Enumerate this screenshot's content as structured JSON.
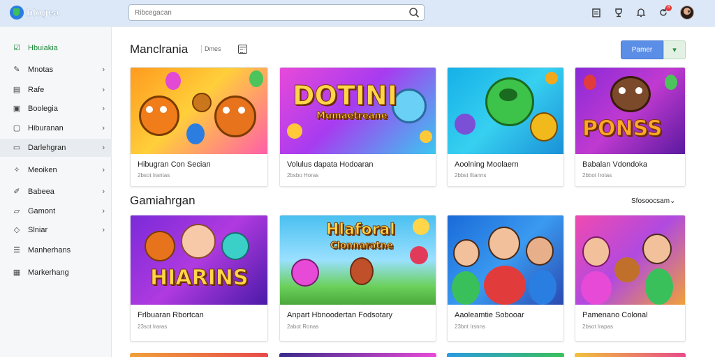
{
  "header": {
    "logo_text": "blogea",
    "search_placeholder": "Ribcegacan",
    "avatar_badge": "8"
  },
  "sidebar": {
    "items": [
      {
        "label": "Hbuiakia",
        "icon": "check-square-icon",
        "chevron": false
      },
      {
        "label": "Mnotas",
        "icon": "pencil-icon",
        "chevron": true
      },
      {
        "label": "Rafe",
        "icon": "doc-icon",
        "chevron": true
      },
      {
        "label": "Boolegia",
        "icon": "image-icon",
        "chevron": true
      },
      {
        "label": "Hiburanan",
        "icon": "square-icon",
        "chevron": true
      },
      {
        "label": "Darlehgran",
        "icon": "folder-icon",
        "chevron": true
      },
      {
        "label": "Meoiken",
        "icon": "star-icon",
        "chevron": true
      },
      {
        "label": "Babeea",
        "icon": "edit-icon",
        "chevron": true
      },
      {
        "label": "Gamont",
        "icon": "chat-icon",
        "chevron": true
      },
      {
        "label": "Slniar",
        "icon": "tag-icon",
        "chevron": true
      },
      {
        "label": "Manherhans",
        "icon": "list-icon",
        "chevron": false
      },
      {
        "label": "Markerhang",
        "icon": "grid-icon",
        "chevron": false
      }
    ]
  },
  "main": {
    "section1": {
      "title": "Manclrania",
      "chip": "Dmes",
      "primary_button": "Pamer",
      "cards": [
        {
          "title": "Hibugran Con Secian",
          "subtitle": "2bsot Irantas"
        },
        {
          "title": "Volulus dapata Hodoaran",
          "subtitle": "2bsbo Horas"
        },
        {
          "title": "Aoolning Moolaern",
          "subtitle": "2bbst Iltanns"
        },
        {
          "title": "Babalan Vdondoka",
          "subtitle": "2bbot Irotas"
        }
      ]
    },
    "section2": {
      "title": "Gamiahrgan",
      "see_more": "Sfosoocsam",
      "cards": [
        {
          "title": "Frlbuaran Rbortcan",
          "subtitle": "23sot Iraras"
        },
        {
          "title": "Anpart Hbnoodertan Fodsotary",
          "subtitle": "2abot Ronas"
        },
        {
          "title": "Aaoleamtie Sobooar",
          "subtitle": "23bnt Irsnns"
        },
        {
          "title": "Pamenano Colonal",
          "subtitle": "2bsot Irapas"
        }
      ]
    },
    "thumb_art": {
      "card2": "DOTINI",
      "card2_sub": "Mumaetreane",
      "card4": "PONSS",
      "card5": "HIARINS",
      "card6": "Hlaforal",
      "card6_sub": "Clonnaratne"
    }
  },
  "colors": {
    "accent_green": "#1f8a3a",
    "primary_blue": "#5b8ee6",
    "header_bg": "#dce8f8"
  }
}
